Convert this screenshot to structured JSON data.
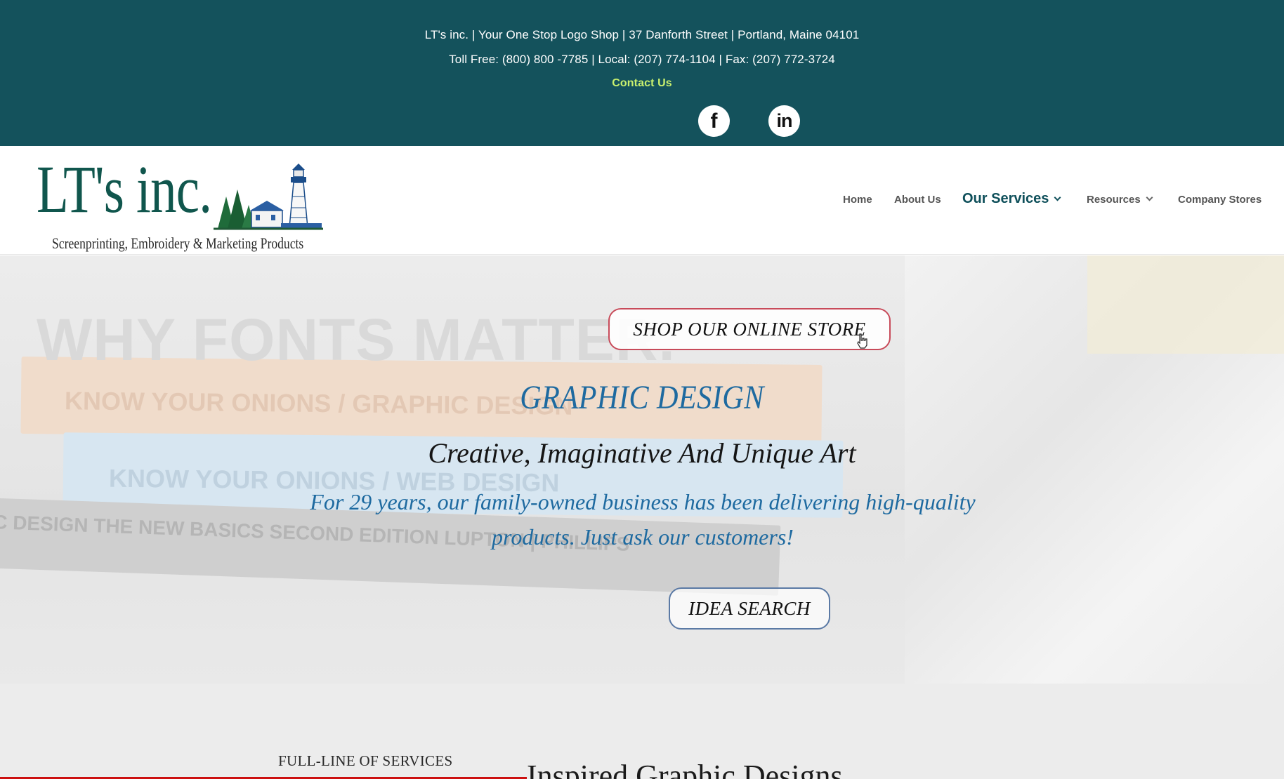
{
  "topbar": {
    "line1": "LT's inc. | Your One Stop Logo Shop | 37 Danforth Street | Portland, Maine 04101",
    "line2": "Toll Free: (800) 800 -7785 | Local: (207) 774-1104 | Fax: (207) 772-3724",
    "contact_label": "Contact Us",
    "social": [
      {
        "name": "facebook-icon",
        "glyph": "f"
      },
      {
        "name": "linkedin-icon",
        "glyph": "in"
      }
    ]
  },
  "logo": {
    "name": "LT's inc.",
    "tagline": "Screenprinting, Embroidery & Marketing Products"
  },
  "nav": {
    "items": [
      {
        "label": "Home",
        "dropdown": false,
        "active": false
      },
      {
        "label": "About Us",
        "dropdown": false,
        "active": false
      },
      {
        "label": "Our Services",
        "dropdown": true,
        "active": true
      },
      {
        "label": "Resources",
        "dropdown": true,
        "active": false
      },
      {
        "label": "Company Stores",
        "dropdown": false,
        "active": false
      }
    ]
  },
  "hero": {
    "bg_title": "WHY FONTS MATTER.",
    "bg_spines": [
      "KNOW YOUR ONIONS / GRAPHIC DESIGN",
      "KNOW YOUR ONIONS / WEB DESIGN",
      "C DESIGN THE NEW BASICS   SECOND EDITION   LUPTON | PHILLIPS"
    ],
    "shop_button": "SHOP OUR ONLINE STORE",
    "heading": "GRAPHIC DESIGN",
    "subheading": "Creative, Imaginative And Unique Art",
    "body": "For 29 years, our family-owned business has been delivering high-quality products. Just ask our customers!",
    "idea_button": "IDEA SEARCH"
  },
  "below": {
    "services_label": "FULL-LINE OF SERVICES",
    "section_title": "Inspired Graphic Designs"
  },
  "colors": {
    "topbar_bg": "#14525c",
    "contact": "#c9f06e",
    "accent_blue": "#1e6aa0",
    "shop_border": "#c84b5a",
    "idea_border": "#5b7aa5"
  }
}
